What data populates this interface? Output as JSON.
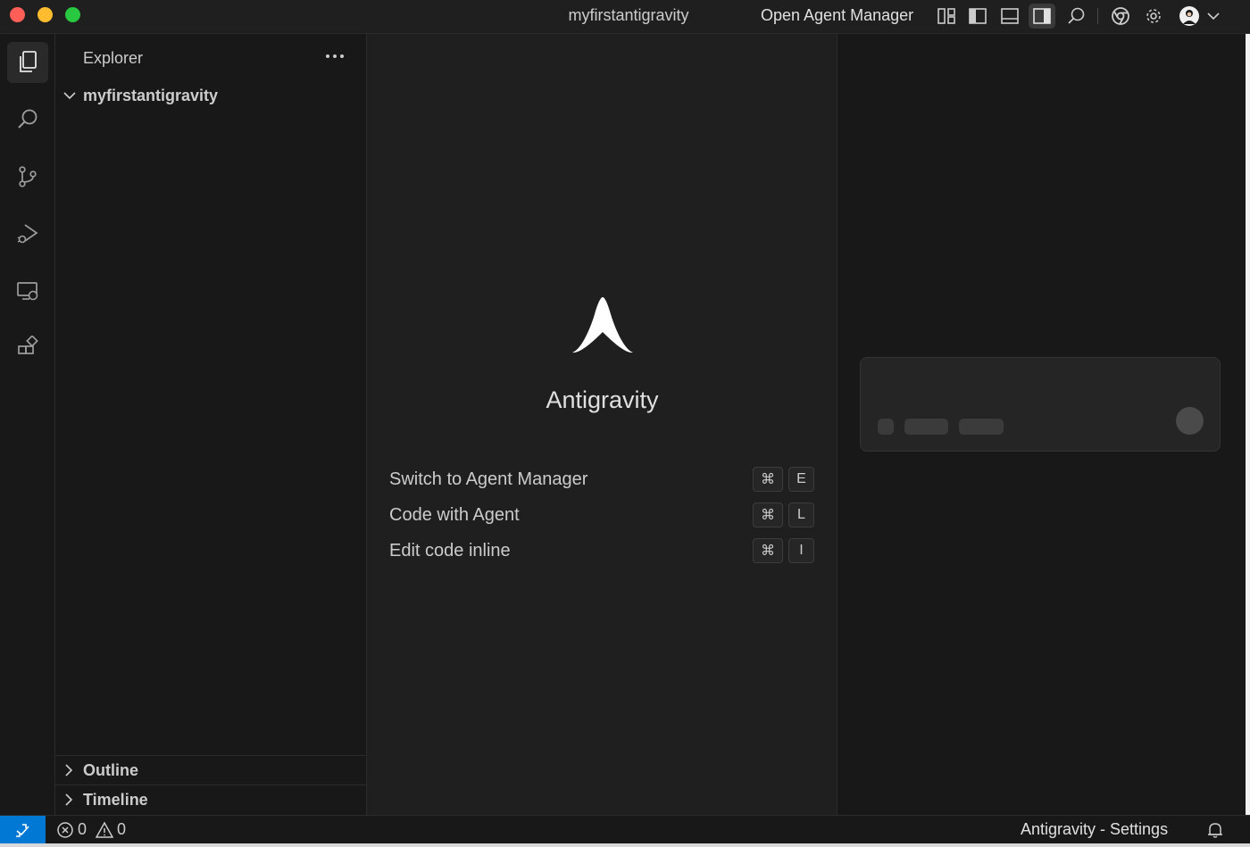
{
  "titlebar": {
    "title": "myfirstantigravity",
    "agent_manager_label": "Open Agent Manager",
    "icons": [
      "layout-customize-icon",
      "toggle-primary-sidebar-icon",
      "toggle-panel-icon",
      "toggle-secondary-sidebar-icon",
      "search-icon",
      "chrome-icon",
      "gear-icon",
      "avatar",
      "chevron-down-icon"
    ]
  },
  "activitybar": {
    "items": [
      "explorer-icon",
      "search-icon",
      "source-control-icon",
      "run-debug-icon",
      "remote-explorer-icon",
      "extensions-icon"
    ]
  },
  "sidebar": {
    "title": "Explorer",
    "folder": "myfirstantigravity",
    "panes": [
      "Outline",
      "Timeline"
    ]
  },
  "editor": {
    "app_name": "Antigravity",
    "shortcuts": [
      {
        "label": "Switch to Agent Manager",
        "keys": [
          "⌘",
          "E"
        ]
      },
      {
        "label": "Code with Agent",
        "keys": [
          "⌘",
          "L"
        ]
      },
      {
        "label": "Edit code inline",
        "keys": [
          "⌘",
          "I"
        ]
      }
    ]
  },
  "statusbar": {
    "errors": "0",
    "warnings": "0",
    "settings_label": "Antigravity - Settings"
  },
  "colors": {
    "accent": "#0078d4",
    "background": "#181818",
    "editor_background": "#1f1f1f"
  }
}
